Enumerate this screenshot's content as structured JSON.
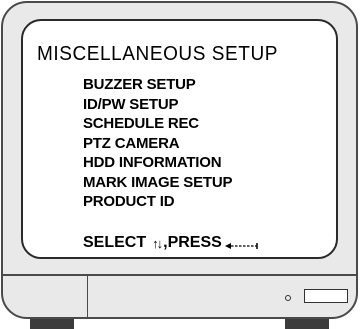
{
  "menu": {
    "title": "MISCELLANEOUS  SETUP",
    "items": [
      {
        "label": "BUZZER SETUP"
      },
      {
        "label": "ID/PW SETUP"
      },
      {
        "label": "SCHEDULE REC"
      },
      {
        "label": "PTZ CAMERA"
      },
      {
        "label": "HDD INFORMATION"
      },
      {
        "label": "MARK IMAGE SETUP"
      },
      {
        "label": "PRODUCT ID"
      }
    ]
  },
  "hint": {
    "select_label": "SELECT",
    "updown_icon": "up-down-arrows-icon",
    "updown_glyph": "↑↓",
    "press_label": ",PRESS",
    "enter_icon": "enter-key-icon"
  },
  "colors": {
    "bezel": "#e9e9e9",
    "screen": "#ffffff",
    "outline": "#4a4a4a"
  }
}
